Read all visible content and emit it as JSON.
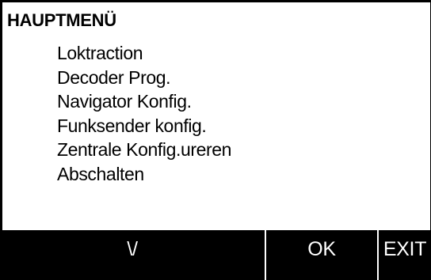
{
  "screen": {
    "title": "HAUPTMENÜ"
  },
  "menu": {
    "items": [
      {
        "label": "Loktraction"
      },
      {
        "label": "Decoder Prog."
      },
      {
        "label": "Navigator Konfig."
      },
      {
        "label": "Funksender konfig."
      },
      {
        "label": "Zentrale Konfig.ureren"
      },
      {
        "label": "Abschalten"
      }
    ]
  },
  "softkeys": {
    "down_label": "\\/",
    "ok_label": "OK",
    "exit_label": "EXIT"
  },
  "colors": {
    "background": "#ffffff",
    "text": "#000000",
    "softkey_bar": "#000000",
    "softkey_text": "#ffffff"
  }
}
